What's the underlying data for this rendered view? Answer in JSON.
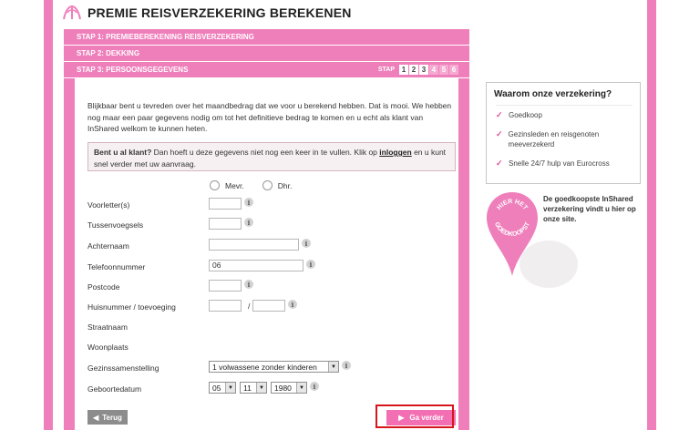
{
  "header": {
    "title": "PREMIE REISVERZEKERING BEREKENEN"
  },
  "steps": {
    "step1": "STAP 1:  PREMIEBEREKENING REISVERZEKERING",
    "step2": "STAP 2:  DEKKING",
    "step3": "STAP 3:  PERSOONSGEGEVENS",
    "nav_label": "STAP",
    "numbers": [
      "1",
      "2",
      "3",
      "4",
      "5",
      "6"
    ]
  },
  "intro": "Blijkbaar bent u tevreden over het maandbedrag dat we voor u berekend hebben. Dat is mooi. We hebben nog maar een paar gegevens nodig om tot het definitieve bedrag te komen en u echt als klant van InShared welkom te kunnen heten.",
  "notice": {
    "bold": "Bent u al klant?",
    "text1": " Dan hoeft u deze gegevens niet nog een keer in te vullen. Klik op ",
    "link": "inloggen",
    "text2": " en u kunt snel verder met uw aanvraag."
  },
  "form": {
    "gender_options": [
      "Mevr.",
      "Dhr."
    ],
    "labels": {
      "initials": "Voorletter(s)",
      "infix": "Tussenvoegsels",
      "surname": "Achternaam",
      "phone": "Telefoonnummer",
      "postcode": "Postcode",
      "house_number": "Huisnummer / toevoeging",
      "street": "Straatnaam",
      "city": "Woonplaats",
      "household": "Gezinssamenstelling",
      "birthdate": "Geboortedatum"
    },
    "phone_value": "06",
    "household_value": "1 volwassene zonder kinderen",
    "birth_day": "05",
    "birth_month": "11",
    "birth_year": "1980",
    "house_sep": "/",
    "info_glyph": "i"
  },
  "buttons": {
    "back": "Terug",
    "next": "Ga verder"
  },
  "sidebar": {
    "why_title": "Waarom onze verzekering?",
    "why_items": [
      "Goedkoop",
      "Gezinsleden en reisgenoten meeverzekerd",
      "Snelle 24/7 hulp van Eurocross"
    ],
    "promo_badge_top": "HIER HET",
    "promo_badge_bottom": "GOEDKOOPST",
    "promo_text": "De goedkoopste InShared verzekering vindt u hier op onze site."
  },
  "colors": {
    "brand_pink": "#ef7fbb",
    "button_pink": "#f26fb3",
    "back_grey": "#8c8c8c",
    "highlight_red": "#d7151c"
  }
}
